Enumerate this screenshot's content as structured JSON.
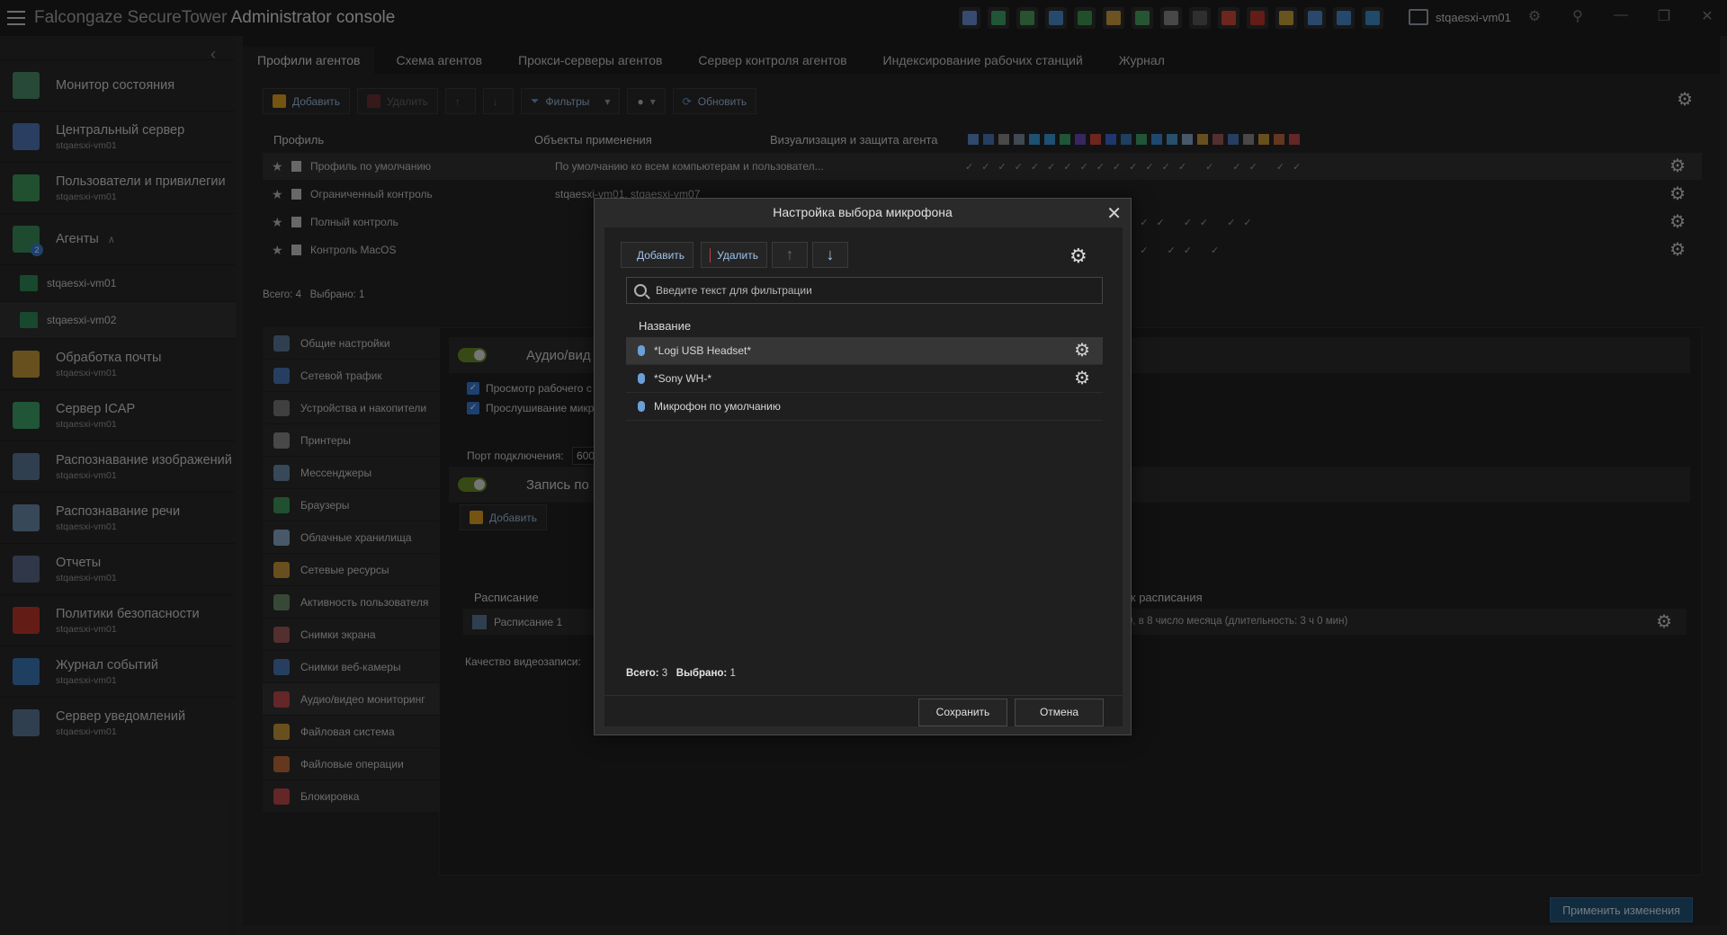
{
  "app": {
    "title_prefix": "Falcongaze SecureTower",
    "title_main": "Administrator console",
    "server": "stqaesxi-vm01"
  },
  "toolbar_icon_colors": [
    "#6a8fd8",
    "#3fa36b",
    "#4f9e5c",
    "#4c8fd0",
    "#3f9a52",
    "#d0a040",
    "#4aa363",
    "#8a8a8a",
    "#5a5a5a",
    "#d24a3a",
    "#c0392b",
    "#c9a23a",
    "#4f8ad0",
    "#4a8ad0",
    "#3f8fcc"
  ],
  "sidebar": {
    "items": [
      {
        "title": "Монитор состояния",
        "sub": "",
        "color": "#4a8f6a"
      },
      {
        "title": "Центральный сервер",
        "sub": "stqaesxi-vm01",
        "color": "#4f77b8"
      },
      {
        "title": "Пользователи и привилегии",
        "sub": "stqaesxi-vm01",
        "color": "#3f9a5a"
      },
      {
        "title": "Агенты",
        "sub": "",
        "color": "#3a8f5a"
      },
      {
        "title": "Обработка почты",
        "sub": "stqaesxi-vm01",
        "color": "#c79a3a"
      },
      {
        "title": "Сервер ICAP",
        "sub": "stqaesxi-vm01",
        "color": "#3fa36b"
      },
      {
        "title": "Распознавание изображений",
        "sub": "stqaesxi-vm01",
        "color": "#5a7a9a"
      },
      {
        "title": "Распознавание речи",
        "sub": "stqaesxi-vm01",
        "color": "#6a8aaa"
      },
      {
        "title": "Отчеты",
        "sub": "stqaesxi-vm01",
        "color": "#5a6a8a"
      },
      {
        "title": "Политики безопасности",
        "sub": "stqaesxi-vm01",
        "color": "#c0392b"
      },
      {
        "title": "Журнал событий",
        "sub": "stqaesxi-vm01",
        "color": "#3a7ab8"
      },
      {
        "title": "Сервер уведомлений",
        "sub": "stqaesxi-vm01",
        "color": "#5a7a9a"
      }
    ],
    "agents_badge": "2",
    "agents_sub": [
      "stqaesxi-vm01",
      "stqaesxi-vm02"
    ]
  },
  "tabs": [
    "Профили агентов",
    "Схема агентов",
    "Прокси-серверы агентов",
    "Сервер контроля агентов",
    "Индексирование рабочих станций",
    "Журнал"
  ],
  "main_toolbar": {
    "add": "Добавить",
    "delete": "Удалить",
    "filters": "Фильтры",
    "refresh": "Обновить"
  },
  "profiles": {
    "columns": [
      "Профиль",
      "Объекты применения",
      "Визуализация и защита агента"
    ],
    "rows": [
      {
        "name": "Профиль по умолчанию",
        "objects": "По умолчанию ко всем компьютерам и пользовател...",
        "checks": "✓✓✓✓✓✓✓✓✓✓✓✓✓✓ ✓ ✓✓ ✓✓"
      },
      {
        "name": "Ограниченный контроль",
        "objects": "stqaesxi-vm01, stqaesxi-vm07",
        "checks": ""
      },
      {
        "name": "Полный контроль",
        "objects": "",
        "checks": "✓✓✓✓✓✓✓✓✓✓ ✓✓ ✓✓ ✓✓"
      },
      {
        "name": "Контроль MacOS",
        "objects": "",
        "checks": "✓✓✓✓✓✓✓✓✓✓ ✓ ✓✓ ✓"
      }
    ],
    "total_label": "Всего:",
    "total": "4",
    "selected_label": "Выбрано:",
    "selected": "1"
  },
  "settings_list": [
    {
      "label": "Общие настройки",
      "color": "#5a7a9a"
    },
    {
      "label": "Сетевой трафик",
      "color": "#4a7ab8"
    },
    {
      "label": "Устройства и накопители",
      "color": "#7a7a7a"
    },
    {
      "label": "Принтеры",
      "color": "#8a8a8a"
    },
    {
      "label": "Мессенджеры",
      "color": "#6a8aaa"
    },
    {
      "label": "Браузеры",
      "color": "#3f9a5a"
    },
    {
      "label": "Облачные хранилища",
      "color": "#8aaacc"
    },
    {
      "label": "Сетевые ресурсы",
      "color": "#c79a3a"
    },
    {
      "label": "Активность пользователя",
      "color": "#6a8a6a"
    },
    {
      "label": "Снимки экрана",
      "color": "#a05a5a"
    },
    {
      "label": "Снимки веб-камеры",
      "color": "#4a7ab8"
    },
    {
      "label": "Аудио/видео мониторинг",
      "color": "#c04a4a"
    },
    {
      "label": "Файловая система",
      "color": "#c79a3a"
    },
    {
      "label": "Файловые операции",
      "color": "#c06a3a"
    },
    {
      "label": "Блокировка",
      "color": "#c04a4a"
    }
  ],
  "settings_content": {
    "section1": "Аудио/вид",
    "chk1": "Просмотр рабочего с",
    "chk2": "Прослушивание микр",
    "port_label": "Порт подключения:",
    "port_value": "600",
    "section2": "Запись по",
    "add": "Добавить",
    "sched_header": "Расписание",
    "sched_header2": "пуск расписания",
    "sched_name": "Расписание 1",
    "sched_detail": "9:00, в 8 число месяца (длительность: 3 ч 0 мин)",
    "video_quality": "Качество видеозаписи:"
  },
  "apply_button": "Применить изменения",
  "dialog": {
    "title": "Настройка выбора микрофона",
    "add": "Добавить",
    "delete": "Удалить",
    "filter_placeholder": "Введите текст для фильтрации",
    "column": "Название",
    "rows": [
      "*Logi USB Headset*",
      "*Sony WH-*",
      "Микрофон по умолчанию"
    ],
    "total_label": "Всего:",
    "total": "3",
    "selected_label": "Выбрано:",
    "selected": "1",
    "save": "Сохранить",
    "cancel": "Отмена"
  }
}
